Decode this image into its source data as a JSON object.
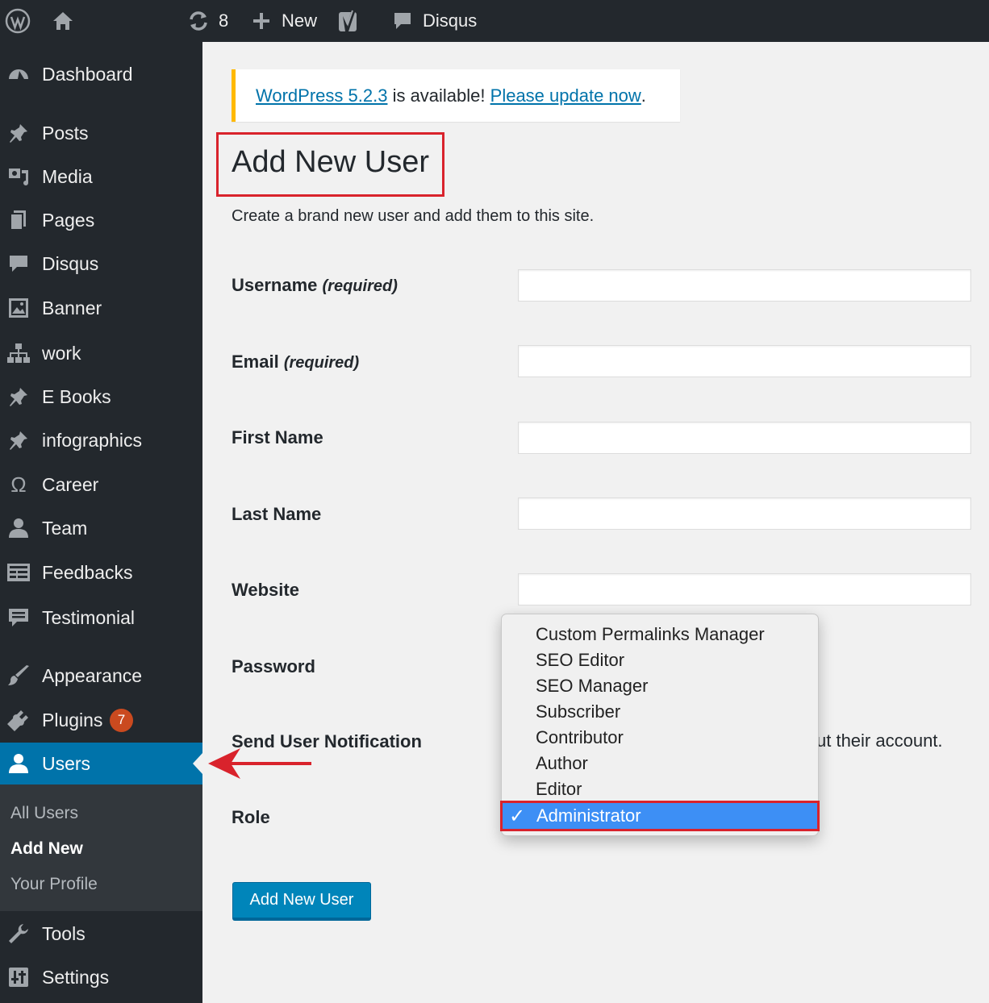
{
  "adminbar": {
    "updates_count": "8",
    "new_label": "New",
    "disqus_label": "Disqus"
  },
  "sidebar": {
    "items": [
      {
        "label": "Dashboard",
        "icon": "dashboard-icon"
      },
      {
        "label": "Posts",
        "icon": "pin-icon"
      },
      {
        "label": "Media",
        "icon": "media-icon"
      },
      {
        "label": "Pages",
        "icon": "pages-icon"
      },
      {
        "label": "Disqus",
        "icon": "comment-icon"
      },
      {
        "label": "Banner",
        "icon": "image-icon"
      },
      {
        "label": "work",
        "icon": "sitemap-icon"
      },
      {
        "label": "E Books",
        "icon": "pin-icon"
      },
      {
        "label": "infographics",
        "icon": "pin-icon"
      },
      {
        "label": "Career",
        "icon": "omega-icon"
      },
      {
        "label": "Team",
        "icon": "user-icon"
      },
      {
        "label": "Feedbacks",
        "icon": "feedback-icon"
      },
      {
        "label": "Testimonial",
        "icon": "testimonial-icon"
      },
      {
        "label": "Appearance",
        "icon": "brush-icon"
      },
      {
        "label": "Plugins",
        "icon": "plugin-icon",
        "badge": "7"
      },
      {
        "label": "Users",
        "icon": "user-icon",
        "current": true
      },
      {
        "label": "Tools",
        "icon": "wrench-icon"
      },
      {
        "label": "Settings",
        "icon": "settings-icon"
      }
    ],
    "submenu": [
      "All Users",
      "Add New",
      "Your Profile"
    ]
  },
  "notice": {
    "version_link": "WordPress 5.2.3",
    "middle": " is available! ",
    "update_link": "Please update now",
    "end": "."
  },
  "page": {
    "title": "Add New User",
    "description": "Create a brand new user and add them to this site."
  },
  "form": {
    "username_label": "Username",
    "email_label": "Email",
    "required_text": "(required)",
    "first_name_label": "First Name",
    "last_name_label": "Last Name",
    "website_label": "Website",
    "password_label": "Password",
    "notification_label": "Send User Notification",
    "notification_tail": "ut their account.",
    "role_label": "Role",
    "submit_label": "Add New User"
  },
  "role_dropdown": {
    "options": [
      "Custom Permalinks Manager",
      "SEO Editor",
      "SEO Manager",
      "Subscriber",
      "Contributor",
      "Author",
      "Editor"
    ],
    "selected": "Administrator",
    "check": "✓"
  },
  "colors": {
    "adminbar_bg": "#23282d",
    "current_menu": "#0073aa",
    "highlight_red": "#d9232c",
    "notice_border": "#ffb900",
    "button": "#0085ba",
    "selected_option": "#3d8ff5"
  }
}
